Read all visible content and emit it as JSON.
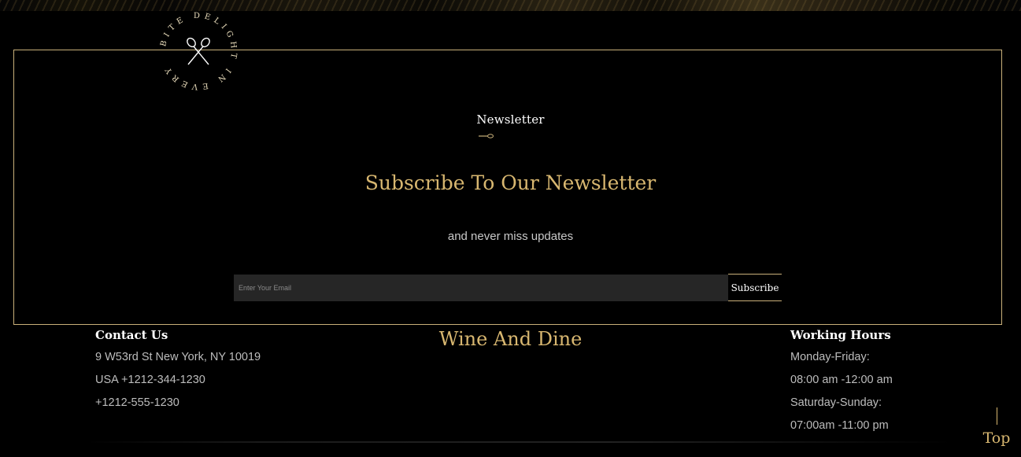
{
  "badge": {
    "text": "BITE DELIGHT IN EVERY",
    "icon": "crossed-spoons-icon"
  },
  "newsletter": {
    "tag": "Newsletter",
    "title": "Subscribe To Our Newsletter",
    "subtitle": "and never miss updates",
    "email_placeholder": "Enter Your Email",
    "email_value": "",
    "subscribe_label": "Subscribe"
  },
  "footer": {
    "contact": {
      "heading": "Contact Us",
      "lines": [
        "9 W53rd St New York, NY 10019",
        "USA +1212-344-1230",
        "+1212-555-1230"
      ]
    },
    "brand": "Wine And Dine",
    "hours": {
      "heading": "Working Hours",
      "lines": [
        "Monday-Friday:",
        "08:00 am -12:00 am",
        "Saturday-Sunday:",
        "07:00am -11:00 pm"
      ]
    }
  },
  "back_to_top": {
    "label": "Top",
    "icon": "vertical-line-icon"
  },
  "colors": {
    "accent": "#d8b770",
    "border": "#c9b07a",
    "background": "#000000",
    "input_bg": "#262626"
  }
}
